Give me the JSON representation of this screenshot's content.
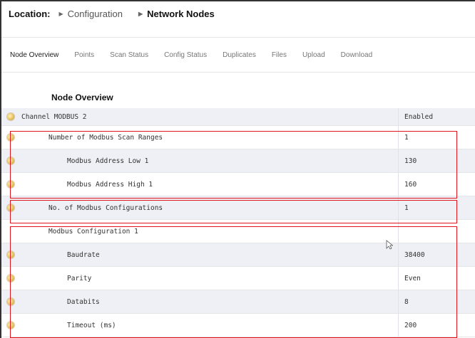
{
  "location": {
    "label": "Location:",
    "crumbs": [
      "Configuration",
      "Network Nodes"
    ]
  },
  "tabs": [
    "Node Overview",
    "Points",
    "Scan Status",
    "Config Status",
    "Duplicates",
    "Files",
    "Upload",
    "Download"
  ],
  "section_title": "Node Overview",
  "rows": [
    {
      "label": "Channel MODBUS 2",
      "value": "Enabled"
    },
    {
      "label": "Number of Modbus Scan Ranges",
      "value": "1"
    },
    {
      "label": "Modbus Address Low 1",
      "value": "130"
    },
    {
      "label": "Modbus Address High 1",
      "value": "160"
    },
    {
      "label": "No. of Modbus Configurations",
      "value": "1"
    },
    {
      "label": "Modbus Configuration 1",
      "value": ""
    },
    {
      "label": "Baudrate",
      "value": "38400"
    },
    {
      "label": "Parity",
      "value": "Even"
    },
    {
      "label": "Databits",
      "value": "8"
    },
    {
      "label": "Timeout (ms)",
      "value": "200"
    }
  ],
  "icons": {
    "row_icon": "gear-icon",
    "arrow": "breadcrumb-arrow-icon"
  },
  "colors": {
    "highlight": "#e0141b",
    "shaded_row": "#eef0f5"
  }
}
